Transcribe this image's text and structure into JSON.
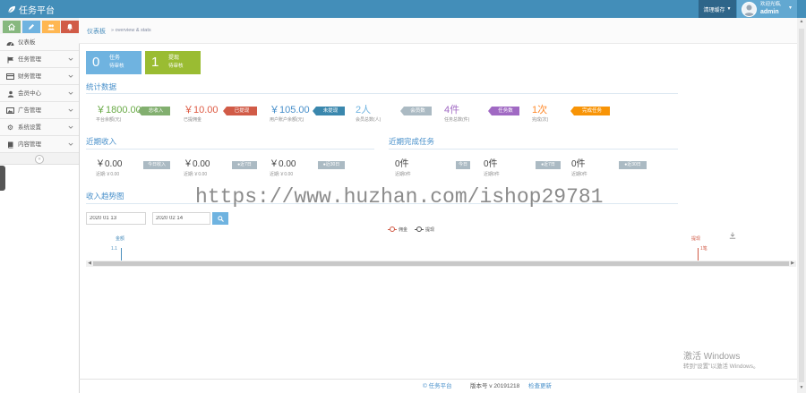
{
  "navbar": {
    "brand": "任务平台",
    "brand_icon": "leaf-icon",
    "clear_cache": "清理缓存",
    "welcome": "欢迎光临,",
    "username": "admin",
    "color": "#438eb9"
  },
  "shortcuts": [
    {
      "icon": "home-icon",
      "color": "#87b87f"
    },
    {
      "icon": "pencil-icon",
      "color": "#6fb3e0"
    },
    {
      "icon": "users-icon",
      "color": "#ffb752"
    },
    {
      "icon": "bell-icon",
      "color": "#d15b47"
    }
  ],
  "sidebar": {
    "items": [
      {
        "label": "仪表板",
        "icon": "dashboard-icon"
      },
      {
        "label": "任务管理",
        "icon": "flag-icon"
      },
      {
        "label": "财务管理",
        "icon": "credit-card-icon"
      },
      {
        "label": "会员中心",
        "icon": "user-icon"
      },
      {
        "label": "广告管理",
        "icon": "picture-icon"
      },
      {
        "label": "系统设置",
        "icon": "cog-icon"
      },
      {
        "label": "内容管理",
        "icon": "book-icon"
      }
    ],
    "collapse": "«"
  },
  "breadcrumb": {
    "home": "仪表板",
    "sub": "» overview & stats"
  },
  "pending": [
    {
      "count": "0",
      "title": "任务",
      "status": "待审核",
      "color": "#6fb3e0"
    },
    {
      "count": "1",
      "title": "提现",
      "status": "待审核",
      "color": "#9abc32"
    }
  ],
  "stats": {
    "title": "统计数据",
    "items": [
      {
        "value": "￥1800.00",
        "label": "平台余额(元)",
        "badge": "总收入",
        "color": "#69aa46",
        "badge_color": "#82af6f"
      },
      {
        "value": "￥10.00",
        "label": "已提佣金",
        "badge": "已提现",
        "color": "#dd5a43",
        "badge_color": "#d15b47"
      },
      {
        "value": "￥105.00",
        "label": "用户账户余额(元)",
        "badge": "未提现",
        "color": "#478fca",
        "badge_color": "#3a87ad"
      },
      {
        "value": "2人",
        "label": "会员总数(人)",
        "badge": "会员数",
        "color": "#6fb3e0",
        "badge_color": "#abbac3"
      },
      {
        "value": "4件",
        "label": "任务总数(件)",
        "badge": "任务数",
        "color": "#a069c3",
        "badge_color": "#a069c3"
      },
      {
        "value": "1次",
        "label": "完成(次)",
        "badge": "完成任务",
        "color": "#ff892a",
        "badge_color": "#f89406"
      }
    ]
  },
  "recent_income": {
    "title": "近期收入",
    "items": [
      {
        "value": "￥0.00",
        "label": "近期:￥0.00",
        "badge": "今日收入"
      },
      {
        "value": "￥0.00",
        "label": "近期:￥0.00",
        "badge": "●近7日"
      },
      {
        "value": "￥0.00",
        "label": "近期:￥0.00",
        "badge": "●近30日"
      }
    ]
  },
  "recent_tasks": {
    "title": "近期完成任务",
    "items": [
      {
        "value": "0件",
        "label": "近期0件",
        "badge": "今日"
      },
      {
        "value": "0件",
        "label": "近期0件",
        "badge": "●近7日"
      },
      {
        "value": "0件",
        "label": "近期0件",
        "badge": "●近30日"
      }
    ]
  },
  "trend": {
    "title": "收入趋势图",
    "start_date": "2020 01 13",
    "end_date": "2020 02 14",
    "legend": [
      {
        "name": "佣金",
        "color": "#d15b47"
      },
      {
        "name": "提现",
        "color": "#555555"
      }
    ],
    "points": [
      {
        "series": "金额",
        "value": "1.1",
        "color": "#4c8fbd"
      },
      {
        "series": "提现",
        "value": "1笔",
        "color": "#d15b47"
      }
    ]
  },
  "watermark": "https://www.huzhan.com/ishop29781",
  "windows_activation": {
    "title": "激活 Windows",
    "hint": "转到“设置”以激活 Windows。"
  },
  "footer": {
    "copyright": "© 任务平台",
    "version": "版本号 v 20191218",
    "check_update": "检查更新"
  }
}
